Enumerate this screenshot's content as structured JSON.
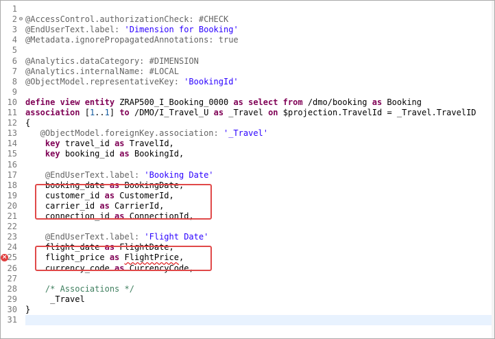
{
  "editor": {
    "line_numbers": [
      "1",
      "2",
      "3",
      "4",
      "5",
      "6",
      "7",
      "8",
      "9",
      "10",
      "11",
      "12",
      "13",
      "14",
      "15",
      "16",
      "17",
      "18",
      "19",
      "20",
      "21",
      "22",
      "23",
      "24",
      "25",
      "26",
      "27",
      "28",
      "29",
      "30",
      "31"
    ],
    "current_line": 31,
    "error_line": 25,
    "fold_line": 2,
    "lines": [
      [],
      [
        {
          "t": "@AccessControl.authorizationCheck: #CHECK",
          "c": "ann"
        }
      ],
      [
        {
          "t": "@EndUserText.label: ",
          "c": "ann"
        },
        {
          "t": "'Dimension for Booking'",
          "c": "str"
        }
      ],
      [
        {
          "t": "@Metadata.ignorePropagatedAnnotations: true",
          "c": "ann"
        }
      ],
      [],
      [
        {
          "t": "@Analytics.dataCategory: #DIMENSION",
          "c": "ann"
        }
      ],
      [
        {
          "t": "@Analytics.internalName: #LOCAL",
          "c": "ann"
        }
      ],
      [
        {
          "t": "@ObjectModel.representativeKey: ",
          "c": "ann"
        },
        {
          "t": "'BookingId'",
          "c": "str"
        }
      ],
      [],
      [
        {
          "t": "define view entity",
          "c": "kw"
        },
        {
          "t": " ZRAP500_I_Booking_0000 ",
          "c": "plain"
        },
        {
          "t": "as select from",
          "c": "kw"
        },
        {
          "t": " /dmo/booking ",
          "c": "plain"
        },
        {
          "t": "as",
          "c": "kw"
        },
        {
          "t": " Booking",
          "c": "plain"
        }
      ],
      [
        {
          "t": "association",
          "c": "kw"
        },
        {
          "t": " [",
          "c": "plain"
        },
        {
          "t": "1",
          "c": "num"
        },
        {
          "t": "..",
          "c": "plain"
        },
        {
          "t": "1",
          "c": "num"
        },
        {
          "t": "] ",
          "c": "plain"
        },
        {
          "t": "to",
          "c": "kw"
        },
        {
          "t": " /DMO/I_Travel_U ",
          "c": "plain"
        },
        {
          "t": "as",
          "c": "kw"
        },
        {
          "t": " _Travel ",
          "c": "plain"
        },
        {
          "t": "on",
          "c": "kw"
        },
        {
          "t": " $projection.TravelId = _Travel.TravelID",
          "c": "plain"
        }
      ],
      [
        {
          "t": "{",
          "c": "plain"
        }
      ],
      [
        {
          "t": "   @ObjectModel.foreignKey.association: ",
          "c": "ann"
        },
        {
          "t": "'_Travel'",
          "c": "str"
        }
      ],
      [
        {
          "t": "    ",
          "c": "plain"
        },
        {
          "t": "key",
          "c": "kw"
        },
        {
          "t": " travel_id ",
          "c": "plain"
        },
        {
          "t": "as",
          "c": "kw"
        },
        {
          "t": " TravelId,",
          "c": "plain"
        }
      ],
      [
        {
          "t": "    ",
          "c": "plain"
        },
        {
          "t": "key",
          "c": "kw"
        },
        {
          "t": " booking_id ",
          "c": "plain"
        },
        {
          "t": "as",
          "c": "kw"
        },
        {
          "t": " BookingId,",
          "c": "plain"
        }
      ],
      [],
      [
        {
          "t": "    @EndUserText.label: ",
          "c": "ann"
        },
        {
          "t": "'Booking Date'",
          "c": "str"
        }
      ],
      [
        {
          "t": "    booking_date ",
          "c": "plain"
        },
        {
          "t": "as",
          "c": "kw"
        },
        {
          "t": " BookingDate,",
          "c": "plain"
        }
      ],
      [
        {
          "t": "    customer_id ",
          "c": "plain"
        },
        {
          "t": "as",
          "c": "kw"
        },
        {
          "t": " CustomerId,",
          "c": "plain"
        }
      ],
      [
        {
          "t": "    carrier_id ",
          "c": "plain"
        },
        {
          "t": "as",
          "c": "kw"
        },
        {
          "t": " CarrierId,",
          "c": "plain"
        }
      ],
      [
        {
          "t": "    connection_id ",
          "c": "plain"
        },
        {
          "t": "as",
          "c": "kw"
        },
        {
          "t": " ConnectionId,",
          "c": "plain"
        }
      ],
      [],
      [
        {
          "t": "    @EndUserText.label: ",
          "c": "ann"
        },
        {
          "t": "'Flight Date'",
          "c": "str"
        }
      ],
      [
        {
          "t": "    flight_date ",
          "c": "plain"
        },
        {
          "t": "as",
          "c": "kw"
        },
        {
          "t": " FlightDate,",
          "c": "plain"
        }
      ],
      [
        {
          "t": "    flight_price ",
          "c": "plain"
        },
        {
          "t": "as",
          "c": "kw"
        },
        {
          "t": " ",
          "c": "plain"
        },
        {
          "t": "FlightPrice",
          "c": "plain err-underline"
        },
        {
          "t": ",",
          "c": "plain"
        }
      ],
      [
        {
          "t": "    currency_code ",
          "c": "plain"
        },
        {
          "t": "as",
          "c": "kw"
        },
        {
          "t": " CurrencyCode,",
          "c": "plain"
        }
      ],
      [],
      [
        {
          "t": "    /* Associations */",
          "c": "cmt"
        }
      ],
      [
        {
          "t": "     _Travel",
          "c": "plain"
        }
      ],
      [
        {
          "t": "}",
          "c": "plain"
        }
      ],
      []
    ],
    "fold_glyph": "⊖",
    "error_glyph": "×",
    "error_icon_name": "error-marker-icon",
    "highlight_color": "#e04848"
  }
}
